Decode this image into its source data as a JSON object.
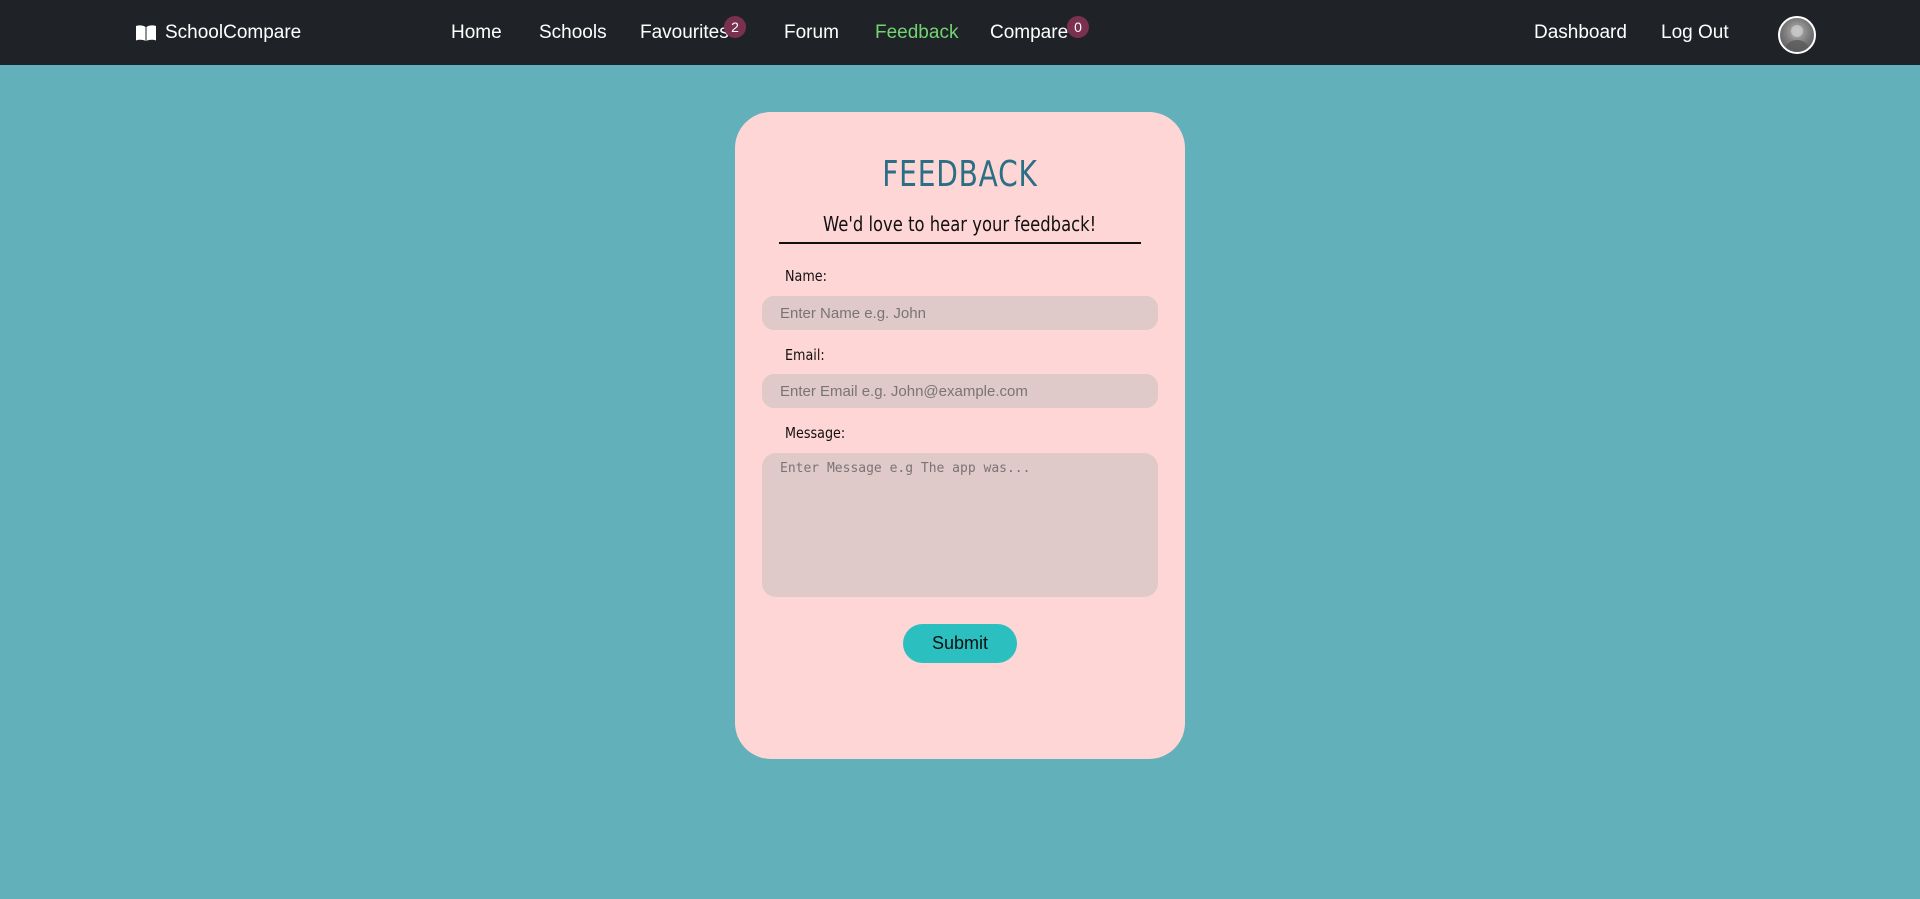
{
  "nav": {
    "brand": "SchoolCompare",
    "brand_icon": "book-open-icon",
    "links": {
      "home": "Home",
      "schools": "Schools",
      "favourites": "Favourites",
      "forum": "Forum",
      "feedback": "Feedback",
      "compare": "Compare",
      "dashboard": "Dashboard",
      "logout": "Log Out"
    },
    "badges": {
      "favourites": "2",
      "compare": "0"
    },
    "active_link": "Feedback",
    "active_color": "#72d472",
    "avatar_icon": "user-avatar"
  },
  "form": {
    "title": "FEEDBACK",
    "subtitle": "We'd love to hear your feedback!",
    "name_label": "Name:",
    "name_placeholder": "Enter Name e.g. John",
    "email_label": "Email:",
    "email_placeholder": "Enter Email e.g. John@example.com",
    "message_label": "Message:",
    "message_placeholder": "Enter Message e.g The app was...",
    "submit_label": "Submit"
  },
  "colors": {
    "page_background": "#62b0b9",
    "navbar": "#1f2327",
    "card": "#ffd6d6",
    "title": "#2a6f86",
    "input_background": "#dfc9c9",
    "submit_button": "#2bbfbf",
    "badge": "#7a3150"
  }
}
